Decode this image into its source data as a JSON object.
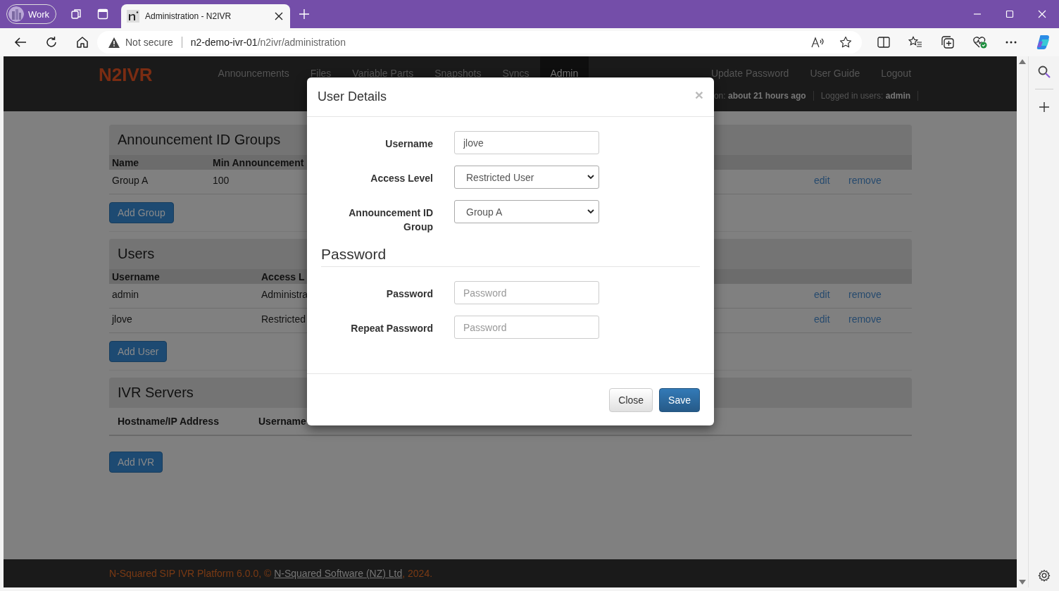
{
  "browser": {
    "profile": "Work",
    "tab": {
      "title": "Administration - N2IVR"
    },
    "security": "Not secure",
    "url": {
      "host": "n2-demo-ivr-01",
      "path": "/n2ivr/administration"
    }
  },
  "navbar": {
    "brand": "N2IVR",
    "items": [
      {
        "label": "Announcements",
        "selected": false
      },
      {
        "label": "Files",
        "selected": false
      },
      {
        "label": "Variable Parts",
        "selected": false
      },
      {
        "label": "Snapshots",
        "selected": false
      },
      {
        "label": "Syncs",
        "selected": false
      },
      {
        "label": "Admin",
        "selected": true
      }
    ],
    "links": [
      "Update Password",
      "User Guide",
      "Logout"
    ],
    "status": [
      {
        "label": "on:",
        "value": "about 21 hours ago"
      },
      {
        "label": "Logged in users:",
        "value": "admin"
      }
    ]
  },
  "sections": [
    {
      "title": "Announcement ID Groups",
      "kind": "groups",
      "columns": [
        "Name",
        "Min Announcement"
      ],
      "rows": [
        {
          "cells": [
            "Group A",
            "100"
          ],
          "actions": [
            "edit",
            "remove"
          ]
        }
      ],
      "button": "Add Group"
    },
    {
      "title": "Users",
      "kind": "users",
      "columns": [
        "Username",
        "Access L"
      ],
      "rows": [
        {
          "cells": [
            "admin",
            "Administra"
          ],
          "actions": [
            "edit",
            "remove"
          ]
        },
        {
          "cells": [
            "jlove",
            "Restricted"
          ],
          "actions": [
            "edit",
            "remove"
          ]
        }
      ],
      "button": "Add User"
    },
    {
      "title": "IVR Servers",
      "kind": "servers",
      "columns": [
        "Hostname/IP Address",
        "Username"
      ],
      "button": "Add IVR"
    }
  ],
  "footer": {
    "before": "N-Squared SIP IVR Platform 6.0.0, © ",
    "link": "N-Squared Software (NZ) Ltd",
    "after": ", 2024."
  },
  "modal": {
    "title": "User Details",
    "close": "×",
    "fields": [
      {
        "label": "Username",
        "kind": "text",
        "value": "jlove"
      },
      {
        "label": "Access Level",
        "kind": "select",
        "value": "Restricted User"
      },
      {
        "label": "Announcement ID Group",
        "kind": "select",
        "value": "Group A"
      }
    ],
    "legend": "Password",
    "password_fields": [
      {
        "label": "Password",
        "kind": "password",
        "placeholder": "Password"
      },
      {
        "label": "Repeat Password",
        "kind": "password",
        "placeholder": "Password"
      }
    ],
    "buttons": [
      {
        "label": "Close",
        "kind": "default"
      },
      {
        "label": "Save",
        "kind": "primary"
      }
    ]
  }
}
